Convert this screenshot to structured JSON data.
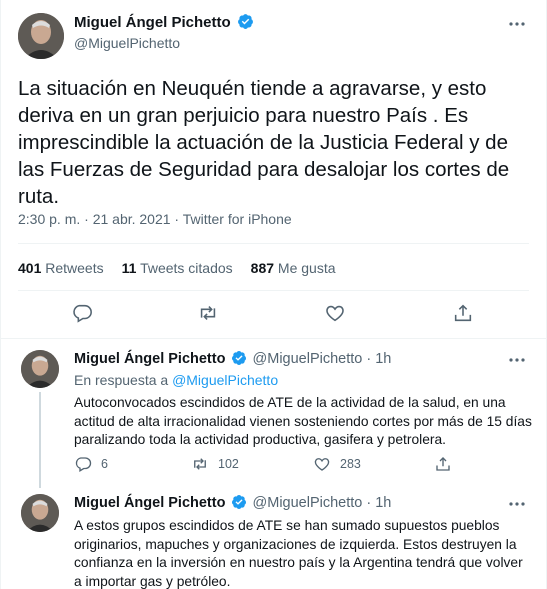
{
  "main_tweet": {
    "author_name": "Miguel Ángel Pichetto",
    "author_handle": "@MiguelPichetto",
    "text": "La situación en Neuquén tiende a agravarse, y esto deriva en un gran perjuicio para nuestro País . Es imprescindible la actuación de la Justicia Federal y de las Fuerzas de Seguridad para desalojar los cortes de ruta.",
    "timestamp": "2:30 p. m. · 21 abr. 2021 · Twitter for iPhone",
    "stats": {
      "retweets_count": "401",
      "retweets_label": "Retweets",
      "quotes_count": "11",
      "quotes_label": "Tweets citados",
      "likes_count": "887",
      "likes_label": "Me gusta"
    }
  },
  "replies": [
    {
      "author_name": "Miguel Ángel Pichetto",
      "author_handle": "@MiguelPichetto",
      "time": "· 1h",
      "reply_prefix": "En respuesta a",
      "reply_to": "@MiguelPichetto",
      "text": "Autoconvocados escindidos de ATE de la actividad de la salud, en una actitud de alta irracionalidad vienen sosteniendo cortes por más de 15 días paralizando toda la actividad productiva, gasifera y petrolera.",
      "reply_count": "6",
      "retweet_count": "102",
      "like_count": "283"
    },
    {
      "author_name": "Miguel Ángel Pichetto",
      "author_handle": "@MiguelPichetto",
      "time": "· 1h",
      "text": "A estos grupos escindidos de ATE se han sumado supuestos pueblos originarios, mapuches y organizaciones de izquierda. Estos destruyen la confianza en la inversión en nuestro país y la Argentina tendrá que volver a importar gas y petróleo."
    }
  ],
  "icons": {
    "verified": "verified-badge-icon",
    "more": "more-dots-icon",
    "reply": "reply-icon",
    "retweet": "retweet-icon",
    "like": "heart-icon",
    "share": "share-icon"
  },
  "colors": {
    "accent": "#1d9bf0",
    "text": "#0f1419",
    "muted": "#536471",
    "divider": "#eff3f4"
  }
}
